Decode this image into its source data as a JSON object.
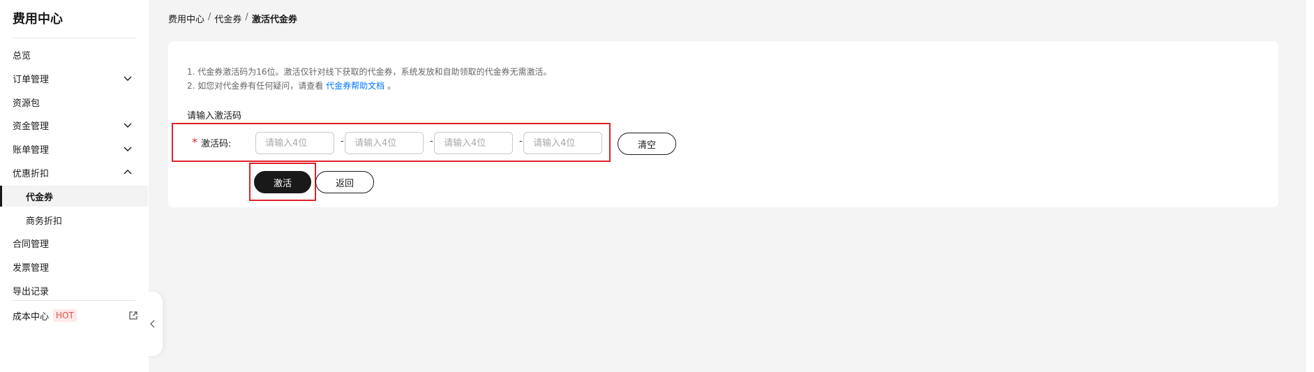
{
  "sidebar": {
    "title": "费用中心",
    "items": [
      {
        "label": "总览"
      },
      {
        "label": "订单管理"
      },
      {
        "label": "资源包"
      },
      {
        "label": "资金管理"
      },
      {
        "label": "账单管理"
      },
      {
        "label": "优惠折扣"
      },
      {
        "label": "代金券"
      },
      {
        "label": "商务折扣"
      },
      {
        "label": "合同管理"
      },
      {
        "label": "发票管理"
      },
      {
        "label": "导出记录"
      },
      {
        "label": "成本中心",
        "badge": "HOT"
      }
    ]
  },
  "breadcrumb": {
    "items": [
      "费用中心",
      "代金券",
      "激活代金券"
    ],
    "separator": "/"
  },
  "form": {
    "tip1": "1. 代金券激活码为16位。激活仅针对线下获取的代金券，系统发放和自助领取的代金券无需激活。",
    "tip2_prefix": "2. 如您对代金券有任何疑问，请查看",
    "tip2_link": "代金券帮助文档",
    "tip2_suffix": "。",
    "section_label": "请输入激活码",
    "required_mark": "*",
    "code_label": "激活码:",
    "code_placeholder": "请输入4位",
    "dash": "-",
    "clear_label": "清空",
    "activate_label": "激活",
    "back_label": "返回"
  },
  "colors": {
    "accent": "#191919",
    "link": "#0077ff",
    "highlight_border": "#e0202b",
    "hot_badge": "#e0514b"
  }
}
